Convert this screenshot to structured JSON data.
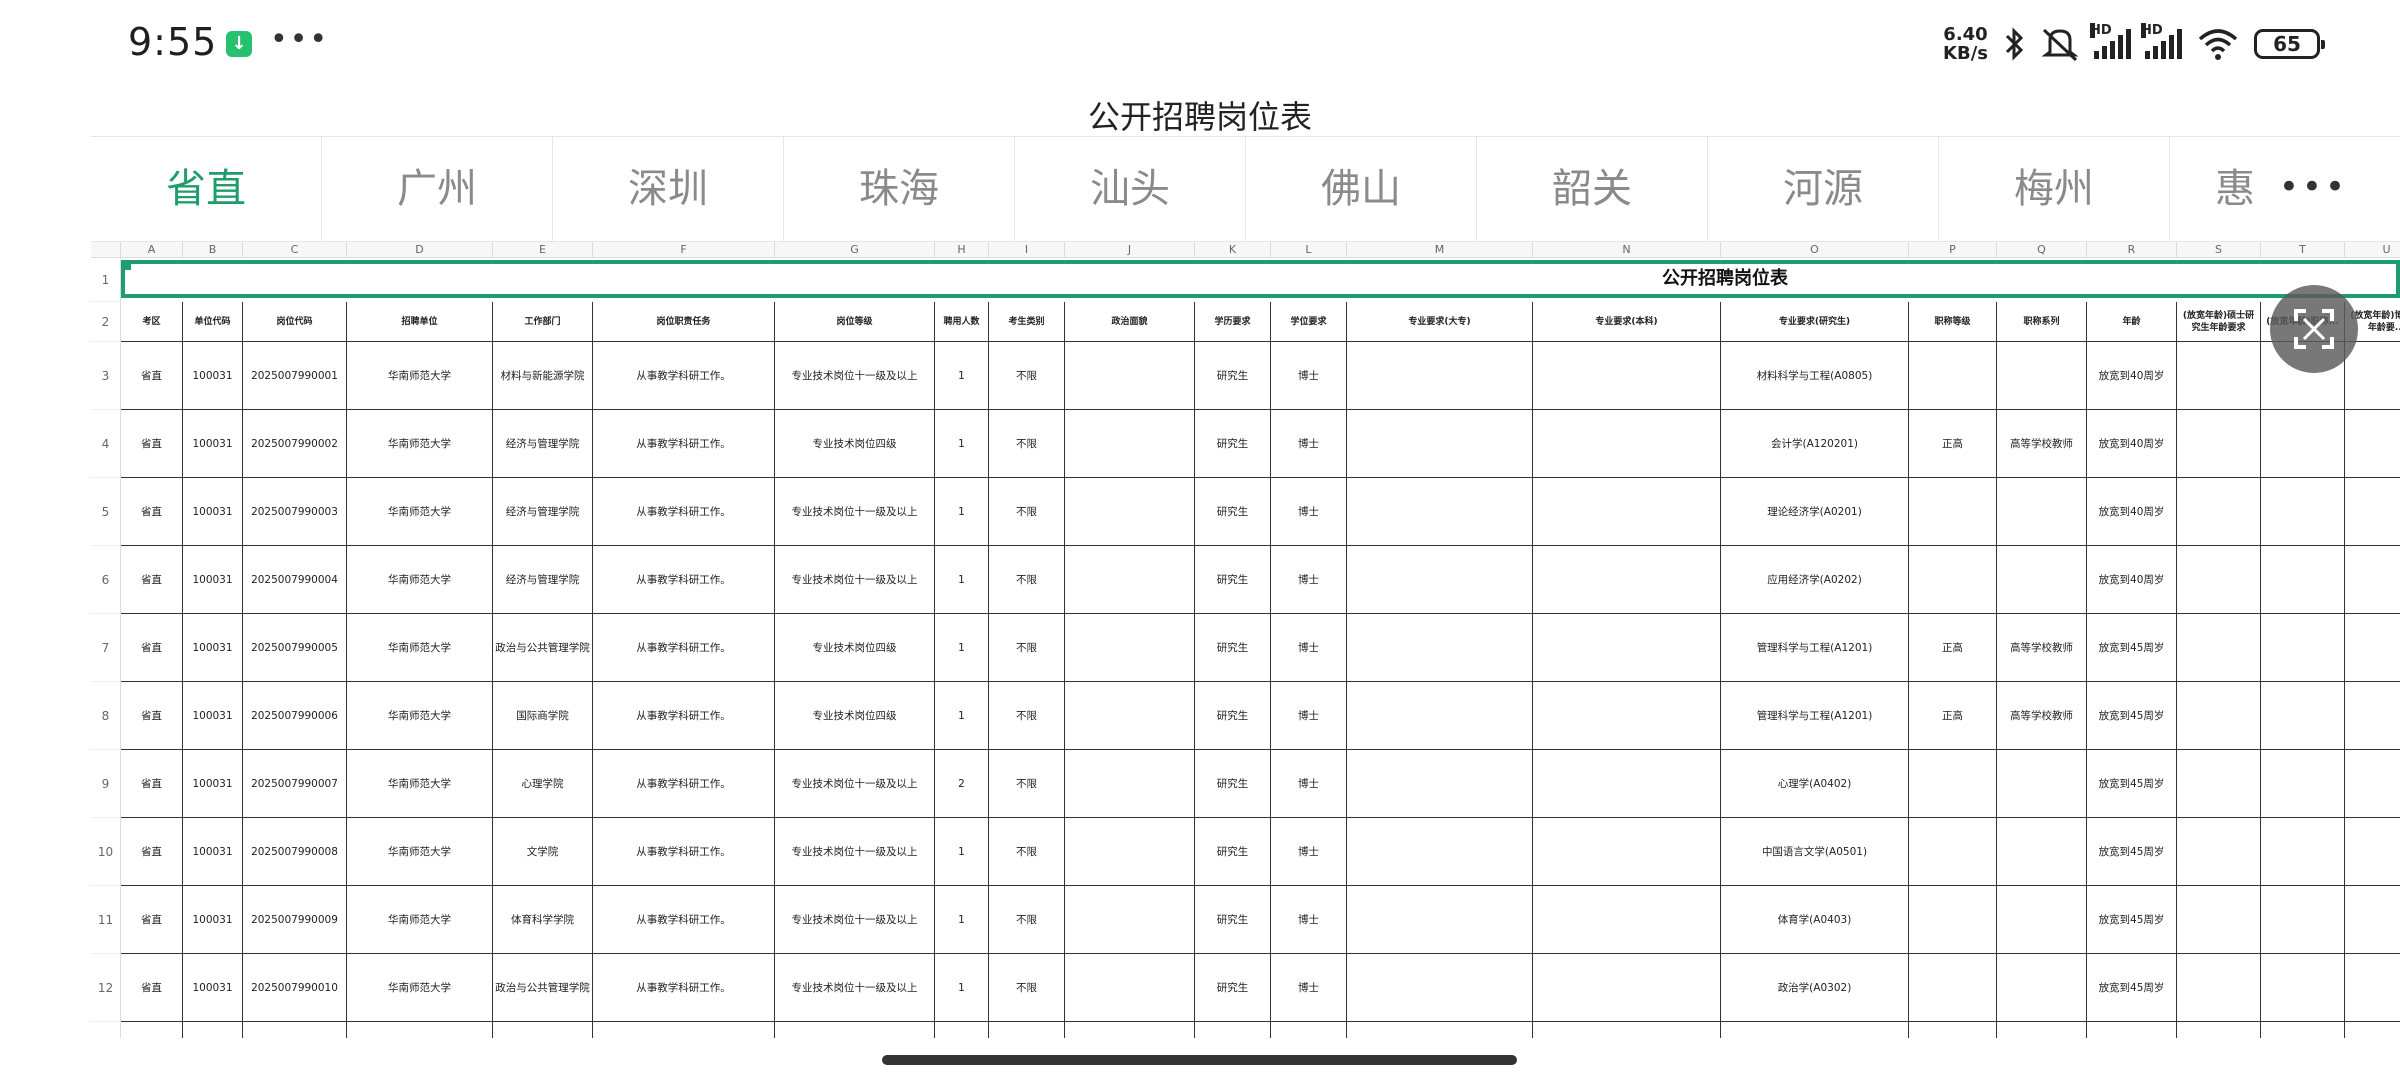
{
  "status": {
    "time": "9:55",
    "net_speed_value": "6.40",
    "net_speed_unit": "KB/s",
    "battery": "65",
    "hd1": "HD",
    "hd2": "HD",
    "icons": [
      "download-icon",
      "more-dots-icon",
      "bluetooth-icon",
      "mute-icon",
      "signal-icon",
      "wifi-icon",
      "battery-icon"
    ]
  },
  "title": "公开招聘岗位表",
  "tabs": [
    "省直",
    "广州",
    "深圳",
    "珠海",
    "汕头",
    "佛山",
    "韶关",
    "河源",
    "梅州",
    "惠"
  ],
  "active_tab": "省直",
  "sheet": {
    "col_letters": [
      "A",
      "B",
      "C",
      "D",
      "E",
      "F",
      "G",
      "H",
      "I",
      "J",
      "K",
      "L",
      "M",
      "N",
      "O",
      "P",
      "Q",
      "R",
      "S",
      "T",
      "U"
    ],
    "header_row": [
      "考区",
      "单位代码",
      "岗位代码",
      "招聘单位",
      "工作部门",
      "岗位职责任务",
      "岗位等级",
      "聘用人数",
      "考生类别",
      "政治面貌",
      "学历要求",
      "学位要求",
      "专业要求(大专)",
      "专业要求(本科)",
      "专业要求(研究生)",
      "职称等级",
      "职称系列",
      "年龄",
      "(放宽年龄)硕士研究生年龄要求",
      "(放宽年龄)职称...",
      "(放宽年龄)博...生年龄要..."
    ],
    "title_cell": "公开招聘岗位表",
    "rows": [
      {
        "n": "3",
        "c": [
          "省直",
          "100031",
          "2025007990001",
          "华南师范大学",
          "材料与新能源学院",
          "从事教学科研工作。",
          "专业技术岗位十一级及以上",
          "1",
          "不限",
          "",
          "研究生",
          "博士",
          "",
          "",
          "材料科学与工程(A0805)",
          "",
          "",
          "放宽到40周岁",
          "",
          "",
          ""
        ]
      },
      {
        "n": "4",
        "c": [
          "省直",
          "100031",
          "2025007990002",
          "华南师范大学",
          "经济与管理学院",
          "从事教学科研工作。",
          "专业技术岗位四级",
          "1",
          "不限",
          "",
          "研究生",
          "博士",
          "",
          "",
          "会计学(A120201)",
          "正高",
          "高等学校教师",
          "放宽到40周岁",
          "",
          "",
          ""
        ]
      },
      {
        "n": "5",
        "c": [
          "省直",
          "100031",
          "2025007990003",
          "华南师范大学",
          "经济与管理学院",
          "从事教学科研工作。",
          "专业技术岗位十一级及以上",
          "1",
          "不限",
          "",
          "研究生",
          "博士",
          "",
          "",
          "理论经济学(A0201)",
          "",
          "",
          "放宽到40周岁",
          "",
          "",
          ""
        ]
      },
      {
        "n": "6",
        "c": [
          "省直",
          "100031",
          "2025007990004",
          "华南师范大学",
          "经济与管理学院",
          "从事教学科研工作。",
          "专业技术岗位十一级及以上",
          "1",
          "不限",
          "",
          "研究生",
          "博士",
          "",
          "",
          "应用经济学(A0202)",
          "",
          "",
          "放宽到40周岁",
          "",
          "",
          ""
        ]
      },
      {
        "n": "7",
        "c": [
          "省直",
          "100031",
          "2025007990005",
          "华南师范大学",
          "政治与公共管理学院",
          "从事教学科研工作。",
          "专业技术岗位四级",
          "1",
          "不限",
          "",
          "研究生",
          "博士",
          "",
          "",
          "管理科学与工程(A1201)",
          "正高",
          "高等学校教师",
          "放宽到45周岁",
          "",
          "",
          ""
        ]
      },
      {
        "n": "8",
        "c": [
          "省直",
          "100031",
          "2025007990006",
          "华南师范大学",
          "国际商学院",
          "从事教学科研工作。",
          "专业技术岗位四级",
          "1",
          "不限",
          "",
          "研究生",
          "博士",
          "",
          "",
          "管理科学与工程(A1201)",
          "正高",
          "高等学校教师",
          "放宽到45周岁",
          "",
          "",
          ""
        ]
      },
      {
        "n": "9",
        "c": [
          "省直",
          "100031",
          "2025007990007",
          "华南师范大学",
          "心理学院",
          "从事教学科研工作。",
          "专业技术岗位十一级及以上",
          "2",
          "不限",
          "",
          "研究生",
          "博士",
          "",
          "",
          "心理学(A0402)",
          "",
          "",
          "放宽到45周岁",
          "",
          "",
          ""
        ]
      },
      {
        "n": "10",
        "c": [
          "省直",
          "100031",
          "2025007990008",
          "华南师范大学",
          "文学院",
          "从事教学科研工作。",
          "专业技术岗位十一级及以上",
          "1",
          "不限",
          "",
          "研究生",
          "博士",
          "",
          "",
          "中国语言文学(A0501)",
          "",
          "",
          "放宽到45周岁",
          "",
          "",
          ""
        ]
      },
      {
        "n": "11",
        "c": [
          "省直",
          "100031",
          "2025007990009",
          "华南师范大学",
          "体育科学学院",
          "从事教学科研工作。",
          "专业技术岗位十一级及以上",
          "1",
          "不限",
          "",
          "研究生",
          "博士",
          "",
          "",
          "体育学(A0403)",
          "",
          "",
          "放宽到45周岁",
          "",
          "",
          ""
        ]
      },
      {
        "n": "12",
        "c": [
          "省直",
          "100031",
          "2025007990010",
          "华南师范大学",
          "政治与公共管理学院",
          "从事教学科研工作。",
          "专业技术岗位十一级及以上",
          "1",
          "不限",
          "",
          "研究生",
          "博士",
          "",
          "",
          "政治学(A0302)",
          "",
          "",
          "放宽到45周岁",
          "",
          "",
          ""
        ]
      }
    ]
  },
  "colors": {
    "accent": "#1f9d6c",
    "tab_inactive": "#8a8a8a"
  }
}
